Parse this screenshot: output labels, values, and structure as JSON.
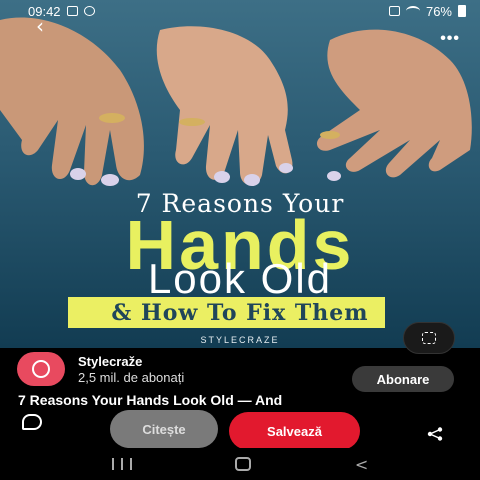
{
  "status_bar": {
    "time": "09:42",
    "battery": "76%"
  },
  "pin": {
    "line1": "7 Reasons Your",
    "line2": "Hands",
    "line3": "Look Old",
    "line4": "& How To Fix Them",
    "brand": "STYLECRAZE"
  },
  "creator": {
    "name": "Stylecraže",
    "subscribers": "2,5 mil. de abonați",
    "follow_label": "Abonare"
  },
  "title": "7 Reasons Your Hands Look Old — And",
  "actions": {
    "read_label": "Citește",
    "save_label": "Salvează"
  },
  "colors": {
    "save_red": "#e2192e",
    "headline_yellow": "#e8f060",
    "banner_yellow": "#ebef63"
  }
}
